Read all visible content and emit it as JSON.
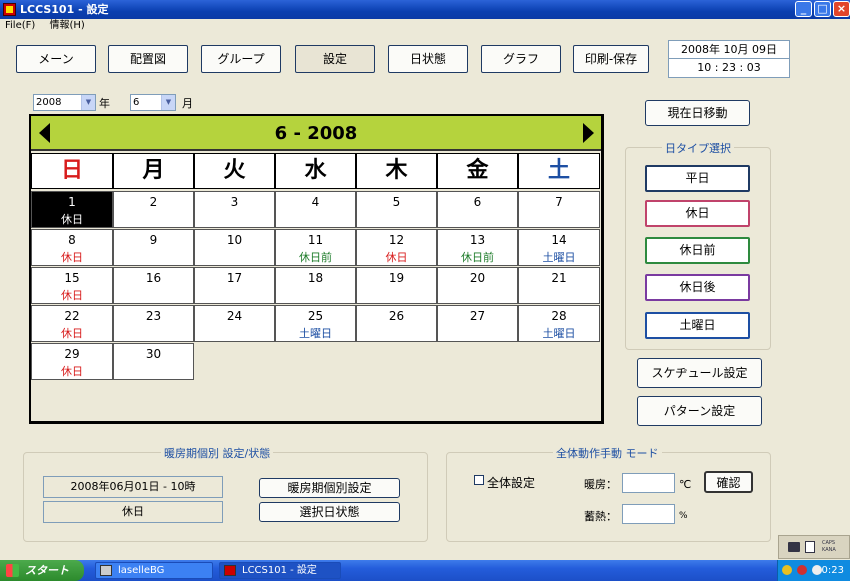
{
  "window": {
    "title": "LCCS101 - 設定",
    "min": "_",
    "max": "□",
    "close": "×"
  },
  "menu": {
    "file": "File(F)",
    "info": "情報(H)"
  },
  "nav": {
    "main": "メーン",
    "layout": "配置図",
    "group": "グループ",
    "settings": "設定",
    "day_status": "日状態",
    "graph": "グラフ",
    "print_save": "印刷-保存"
  },
  "datetime": {
    "date": "2008年 10月 09日",
    "time": "10 : 23 : 03"
  },
  "selectors": {
    "year": "2008",
    "year_unit": "年",
    "month": "6",
    "month_unit": "月"
  },
  "calendar": {
    "title": "6 - 2008",
    "weekdays": [
      "日",
      "月",
      "火",
      "水",
      "木",
      "金",
      "土"
    ],
    "weekday_colors": [
      "#d81c1c",
      "#000000",
      "#000000",
      "#000000",
      "#000000",
      "#000000",
      "#1d4fa3"
    ],
    "rows": [
      [
        {
          "d": "1",
          "t": "休日",
          "c": "sel"
        },
        {
          "d": "2",
          "t": "",
          "c": ""
        },
        {
          "d": "3",
          "t": "",
          "c": ""
        },
        {
          "d": "4",
          "t": "",
          "c": ""
        },
        {
          "d": "5",
          "t": "",
          "c": ""
        },
        {
          "d": "6",
          "t": "",
          "c": ""
        },
        {
          "d": "7",
          "t": "",
          "c": ""
        }
      ],
      [
        {
          "d": "8",
          "t": "休日",
          "c": "red"
        },
        {
          "d": "9",
          "t": "",
          "c": ""
        },
        {
          "d": "10",
          "t": "",
          "c": ""
        },
        {
          "d": "11",
          "t": "休日前",
          "c": "green"
        },
        {
          "d": "12",
          "t": "休日",
          "c": "red"
        },
        {
          "d": "13",
          "t": "休日前",
          "c": "green"
        },
        {
          "d": "14",
          "t": "土曜日",
          "c": "blue"
        }
      ],
      [
        {
          "d": "15",
          "t": "休日",
          "c": "red"
        },
        {
          "d": "16",
          "t": "",
          "c": ""
        },
        {
          "d": "17",
          "t": "",
          "c": ""
        },
        {
          "d": "18",
          "t": "",
          "c": ""
        },
        {
          "d": "19",
          "t": "",
          "c": ""
        },
        {
          "d": "20",
          "t": "",
          "c": ""
        },
        {
          "d": "21",
          "t": "",
          "c": ""
        }
      ],
      [
        {
          "d": "22",
          "t": "休日",
          "c": "red"
        },
        {
          "d": "23",
          "t": "",
          "c": ""
        },
        {
          "d": "24",
          "t": "",
          "c": ""
        },
        {
          "d": "25",
          "t": "土曜日",
          "c": "blue"
        },
        {
          "d": "26",
          "t": "",
          "c": ""
        },
        {
          "d": "27",
          "t": "",
          "c": ""
        },
        {
          "d": "28",
          "t": "土曜日",
          "c": "blue"
        }
      ],
      [
        {
          "d": "29",
          "t": "休日",
          "c": "red"
        },
        {
          "d": "30",
          "t": "",
          "c": ""
        }
      ]
    ]
  },
  "side": {
    "today_button": "現在日移動",
    "daytype_title": "日タイプ選択",
    "types": [
      {
        "label": "平日",
        "color": "#1f3a63"
      },
      {
        "label": "休日",
        "color": "#c0436b"
      },
      {
        "label": "休日前",
        "color": "#2e8a3e"
      },
      {
        "label": "休日後",
        "color": "#7a3aa0"
      },
      {
        "label": "土曜日",
        "color": "#1d4fa3"
      }
    ],
    "schedule_button": "スケヂュール設定",
    "pattern_button": "パターン設定"
  },
  "heating": {
    "title": "暖房期個別 設定/状態",
    "range": "2008年06月01日 - 10時",
    "status": "休日",
    "individual_button": "暖房期個別設定",
    "selected_day_button": "選択日状態"
  },
  "manual": {
    "title": "全体動作手動 モード",
    "all_label": "全体設定",
    "heating_label": "暖房：",
    "heating_unit": "℃",
    "confirm_button": "確認",
    "storage_label": "蓄熱：",
    "storage_unit": "%"
  },
  "taskbar": {
    "start": "スタート",
    "task1": "laselleBG",
    "task2": "LCCS101 - 設定",
    "clock": "10:23"
  }
}
